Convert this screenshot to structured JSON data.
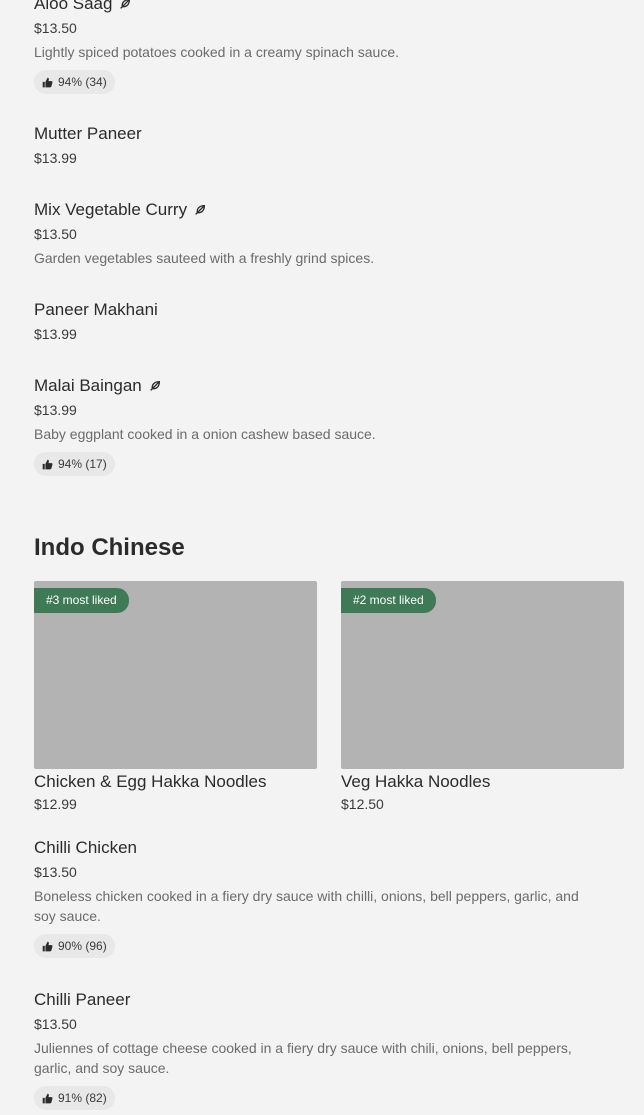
{
  "items": [
    {
      "name": "Aloo Saag",
      "veg": true,
      "price": "$13.50",
      "desc": "Lightly spiced potatoes cooked in a creamy spinach sauce.",
      "rating": "94% (34)"
    },
    {
      "name": "Mutter Paneer",
      "veg": false,
      "price": "$13.99"
    },
    {
      "name": "Mix Vegetable Curry",
      "veg": true,
      "price": "$13.50",
      "desc": "Garden vegetables sauteed with a freshly grind spices."
    },
    {
      "name": "Paneer Makhani",
      "veg": false,
      "price": "$13.99"
    },
    {
      "name": "Malai Baingan",
      "veg": true,
      "price": "$13.99",
      "desc": "Baby eggplant cooked in a onion cashew based sauce.",
      "rating": "94% (17)"
    }
  ],
  "section": {
    "title": "Indo Chinese"
  },
  "featured": [
    {
      "tag": "#3 most liked",
      "name": "Chicken & Egg Hakka Noodles",
      "price": "$12.99"
    },
    {
      "tag": "#2 most liked",
      "name": "Veg Hakka Noodles",
      "price": "$12.50"
    }
  ],
  "items2": [
    {
      "name": "Chilli Chicken",
      "price": "$13.50",
      "desc": "Boneless chicken cooked in a fiery dry sauce with chilli, onions, bell peppers, garlic, and soy sauce.",
      "rating": "90% (96)"
    },
    {
      "name": "Chilli Paneer",
      "price": "$13.50",
      "desc": "Juliennes of cottage cheese cooked in a fiery dry sauce with chili, onions, bell peppers, garlic, and soy sauce.",
      "rating": "91% (82)"
    }
  ],
  "icons": {
    "vegetarian": "leaf-icon",
    "rating": "thumbs-up-icon"
  }
}
